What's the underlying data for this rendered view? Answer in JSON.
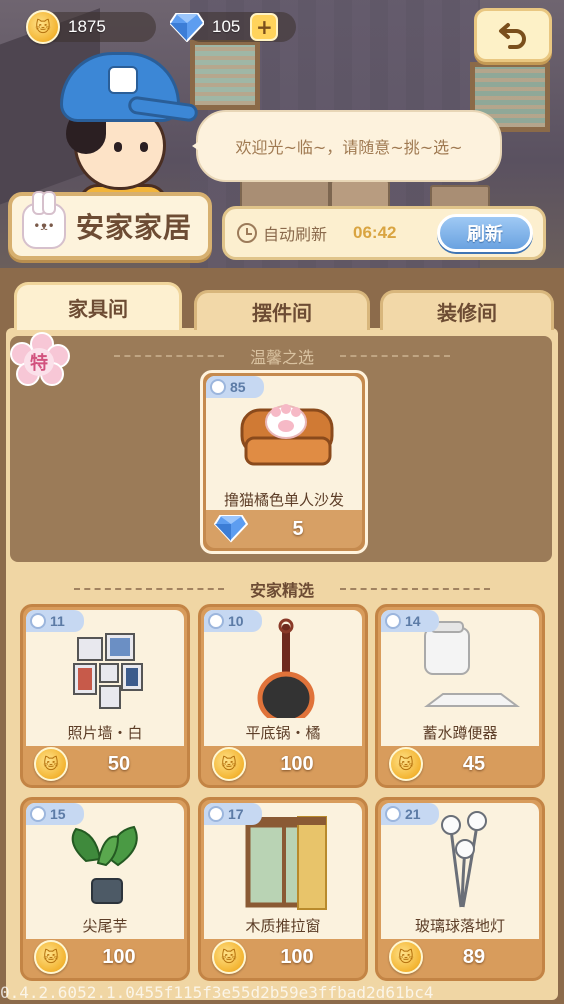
{
  "currency": {
    "coins": "1875",
    "diamonds": "105",
    "plus": "+"
  },
  "shopkeeper": {
    "greeting": "欢迎光~临~，请随意~挑~选~"
  },
  "shop": {
    "name": "安家家居"
  },
  "refresh": {
    "auto_label": "自动刷新",
    "timer": "06:42",
    "button": "刷新"
  },
  "tabs": [
    {
      "label": "家具间",
      "active": true
    },
    {
      "label": "摆件间",
      "active": false
    },
    {
      "label": "装修间",
      "active": false
    }
  ],
  "special": {
    "badge": "特",
    "section_title": "温馨之选",
    "item": {
      "level": "85",
      "name": "撸猫橘色单人沙发",
      "price": "5",
      "currency": "diamond"
    }
  },
  "featured": {
    "section_title": "安家精选",
    "items": [
      {
        "level": "11",
        "name": "照片墙・白",
        "price": "50",
        "currency": "coin"
      },
      {
        "level": "10",
        "name": "平底锅・橘",
        "price": "100",
        "currency": "coin"
      },
      {
        "level": "14",
        "name": "蓄水蹲便器",
        "price": "45",
        "currency": "coin"
      },
      {
        "level": "15",
        "name": "尖尾芋",
        "price": "100",
        "currency": "coin"
      },
      {
        "level": "17",
        "name": "木质推拉窗",
        "price": "100",
        "currency": "coin"
      },
      {
        "level": "21",
        "name": "玻璃球落地灯",
        "price": "89",
        "currency": "coin"
      }
    ]
  },
  "version": "0.4.2.6052.1.0455f115f3e55d2b59e3ffbad2d61bc4",
  "colors": {
    "coin": "#f3b431",
    "diamond": "#4c8ee8",
    "refresh_button": "#6aa2e0",
    "panel": "#f0d6a4",
    "card": "#d89c5c"
  }
}
